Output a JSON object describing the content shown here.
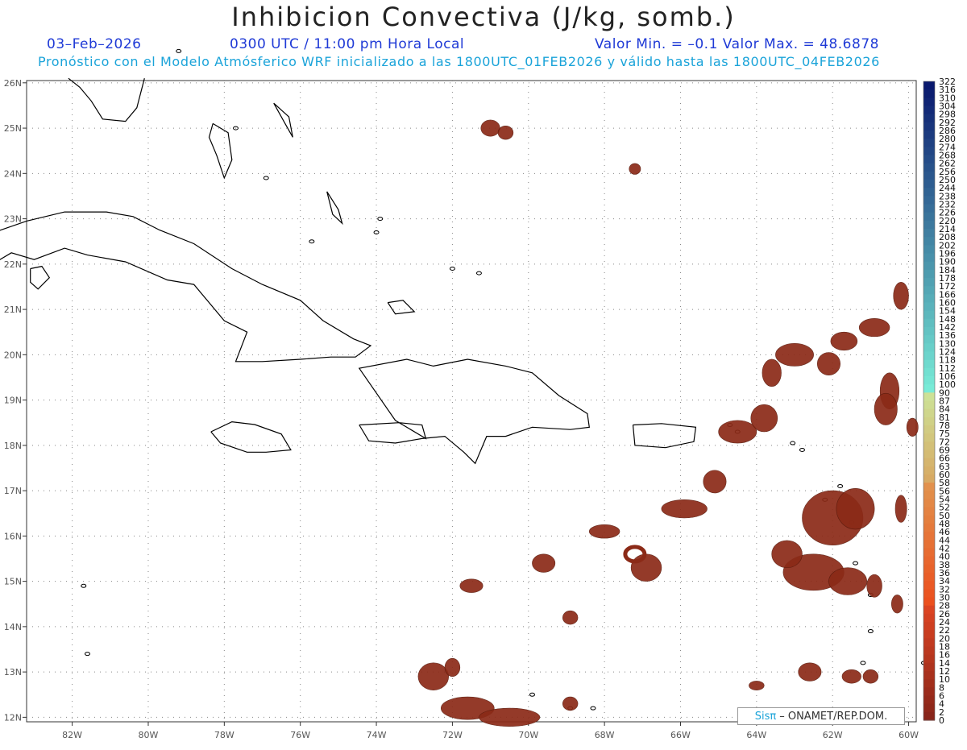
{
  "title": "Inhibicion Convectiva (J/kg, somb.)",
  "header": {
    "date": "03–Feb–2026",
    "time": "0300 UTC / 11:00 pm Hora Local",
    "minmax": "Valor Min. = –0.1  Valor Max. = 48.6878",
    "model": "Pronóstico con el Modelo Atmósferico WRF inicializado a las 1800UTC_01FEB2026 y válido hasta las  1800UTC_04FEB2026"
  },
  "map": {
    "lon_ticks": [
      "82W",
      "80W",
      "78W",
      "76W",
      "74W",
      "72W",
      "70W",
      "68W",
      "66W",
      "64W",
      "62W",
      "60W"
    ],
    "lat_ticks": [
      "26N",
      "25N",
      "24N",
      "23N",
      "22N",
      "21N",
      "20N",
      "19N",
      "18N",
      "17N",
      "16N",
      "15N",
      "14N",
      "13N",
      "12N"
    ],
    "lon_range": [
      -83.2,
      -59.8
    ],
    "lat_range": [
      11.9,
      26.05
    ],
    "grid": true,
    "fill_color": "#8b2a17"
  },
  "colorbar": {
    "labels": [
      "322",
      "316",
      "310",
      "304",
      "298",
      "292",
      "286",
      "280",
      "274",
      "268",
      "262",
      "256",
      "250",
      "244",
      "238",
      "232",
      "226",
      "220",
      "214",
      "208",
      "202",
      "196",
      "190",
      "184",
      "178",
      "172",
      "166",
      "160",
      "154",
      "148",
      "142",
      "136",
      "130",
      "124",
      "118",
      "112",
      "106",
      "100",
      "90",
      "87",
      "84",
      "81",
      "78",
      "75",
      "72",
      "69",
      "66",
      "63",
      "60",
      "58",
      "56",
      "54",
      "52",
      "50",
      "48",
      "46",
      "44",
      "42",
      "40",
      "38",
      "36",
      "34",
      "32",
      "30",
      "28",
      "26",
      "24",
      "22",
      "20",
      "18",
      "16",
      "14",
      "12",
      "10",
      "8",
      "6",
      "4",
      "2",
      "0"
    ]
  },
  "credit": {
    "brand": "Sisπ",
    "org": "– ONAMET/REP.DOM."
  }
}
